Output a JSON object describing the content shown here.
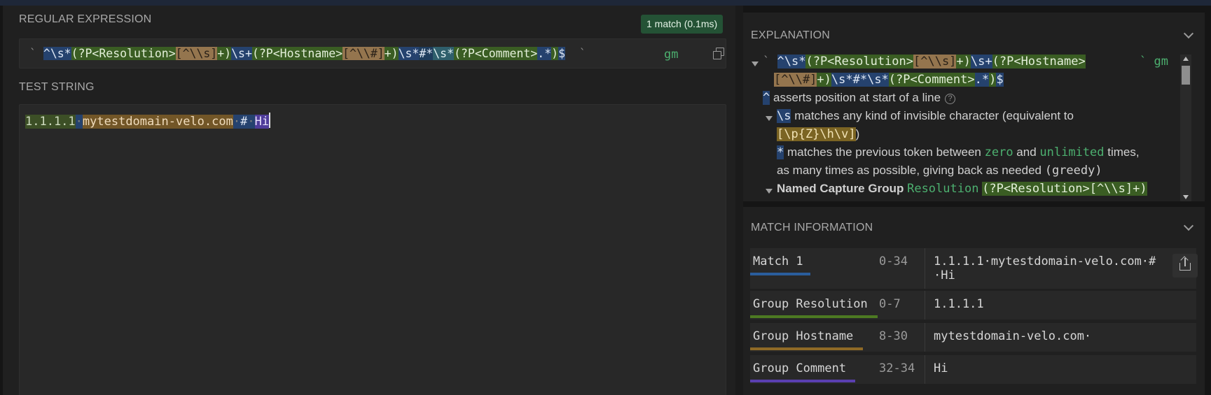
{
  "regex_section": {
    "title": "REGULAR EXPRESSION",
    "match_badge": "1 match (0.1ms)",
    "open_delim": "`",
    "close_delim": "`",
    "flags": "gm",
    "tokens": [
      "^",
      "\\s*",
      "(?P<Resolution>",
      "[^\\\\s]",
      "+)",
      "\\s+",
      "(?P<Hostname>",
      "[^\\\\#]",
      "+)",
      "\\s*",
      "#*",
      "\\s*",
      "(?P<Comment>",
      ".*",
      ")",
      "$"
    ]
  },
  "test_section": {
    "title": "TEST STRING",
    "resolution": "1.1.1.1",
    "hostname": "mytestdomain-velo.com",
    "hash": "#",
    "comment": "Hi",
    "space_dot": "·"
  },
  "explanation": {
    "title": "EXPLANATION",
    "line1_tokens": [
      "^",
      "\\s*",
      "(?P<Resolution>",
      "[^\\\\s]",
      "+)",
      "\\s+",
      "(?P<Hostname>"
    ],
    "line2_tokens": [
      "[^\\\\#]",
      "+)",
      "\\s*#*\\s*",
      "(?P<Comment>",
      ".*",
      ")",
      "$"
    ],
    "open_delim": "`",
    "flags_display": "` gm",
    "caret_token": "^",
    "caret_text": "asserts position at start of a line",
    "help_glyph": "?",
    "ws_token": "\\s",
    "ws_text": "matches any kind of invisible character (equivalent to",
    "ws_equiv": "[\\p{Z}\\h\\v]",
    "ws_close": ")",
    "star_token": "*",
    "star_text_a": "matches the previous token between",
    "star_zero": "zero",
    "star_and": "and",
    "star_unlimited": "unlimited",
    "star_times": "times,",
    "star_line2": "as many times as possible, giving back as needed",
    "star_greedy": "(greedy)",
    "group_line_label": "Named Capture Group",
    "group_line_name": "Resolution",
    "group_line_pattern": "(?P<Resolution>[^\\\\s]+)"
  },
  "match_info": {
    "title": "MATCH INFORMATION",
    "rows": [
      {
        "label": "Match 1",
        "range": "0-34",
        "value_line1": "1.1.1.1·mytestdomain-velo.com·#",
        "value_line2": "·Hi",
        "color": "#2a5d9c"
      },
      {
        "label": "Group Resolution",
        "range": "0-7",
        "value_line1": "1.1.1.1",
        "value_line2": "",
        "color": "#4d7a22"
      },
      {
        "label": "Group Hostname",
        "range": "8-30",
        "value_line1": "mytestdomain-velo.com·",
        "value_line2": "",
        "color": "#8f6a26"
      },
      {
        "label": "Group Comment",
        "range": "32-34",
        "value_line1": "Hi",
        "value_line2": "",
        "color": "#5a3fb0"
      }
    ]
  }
}
